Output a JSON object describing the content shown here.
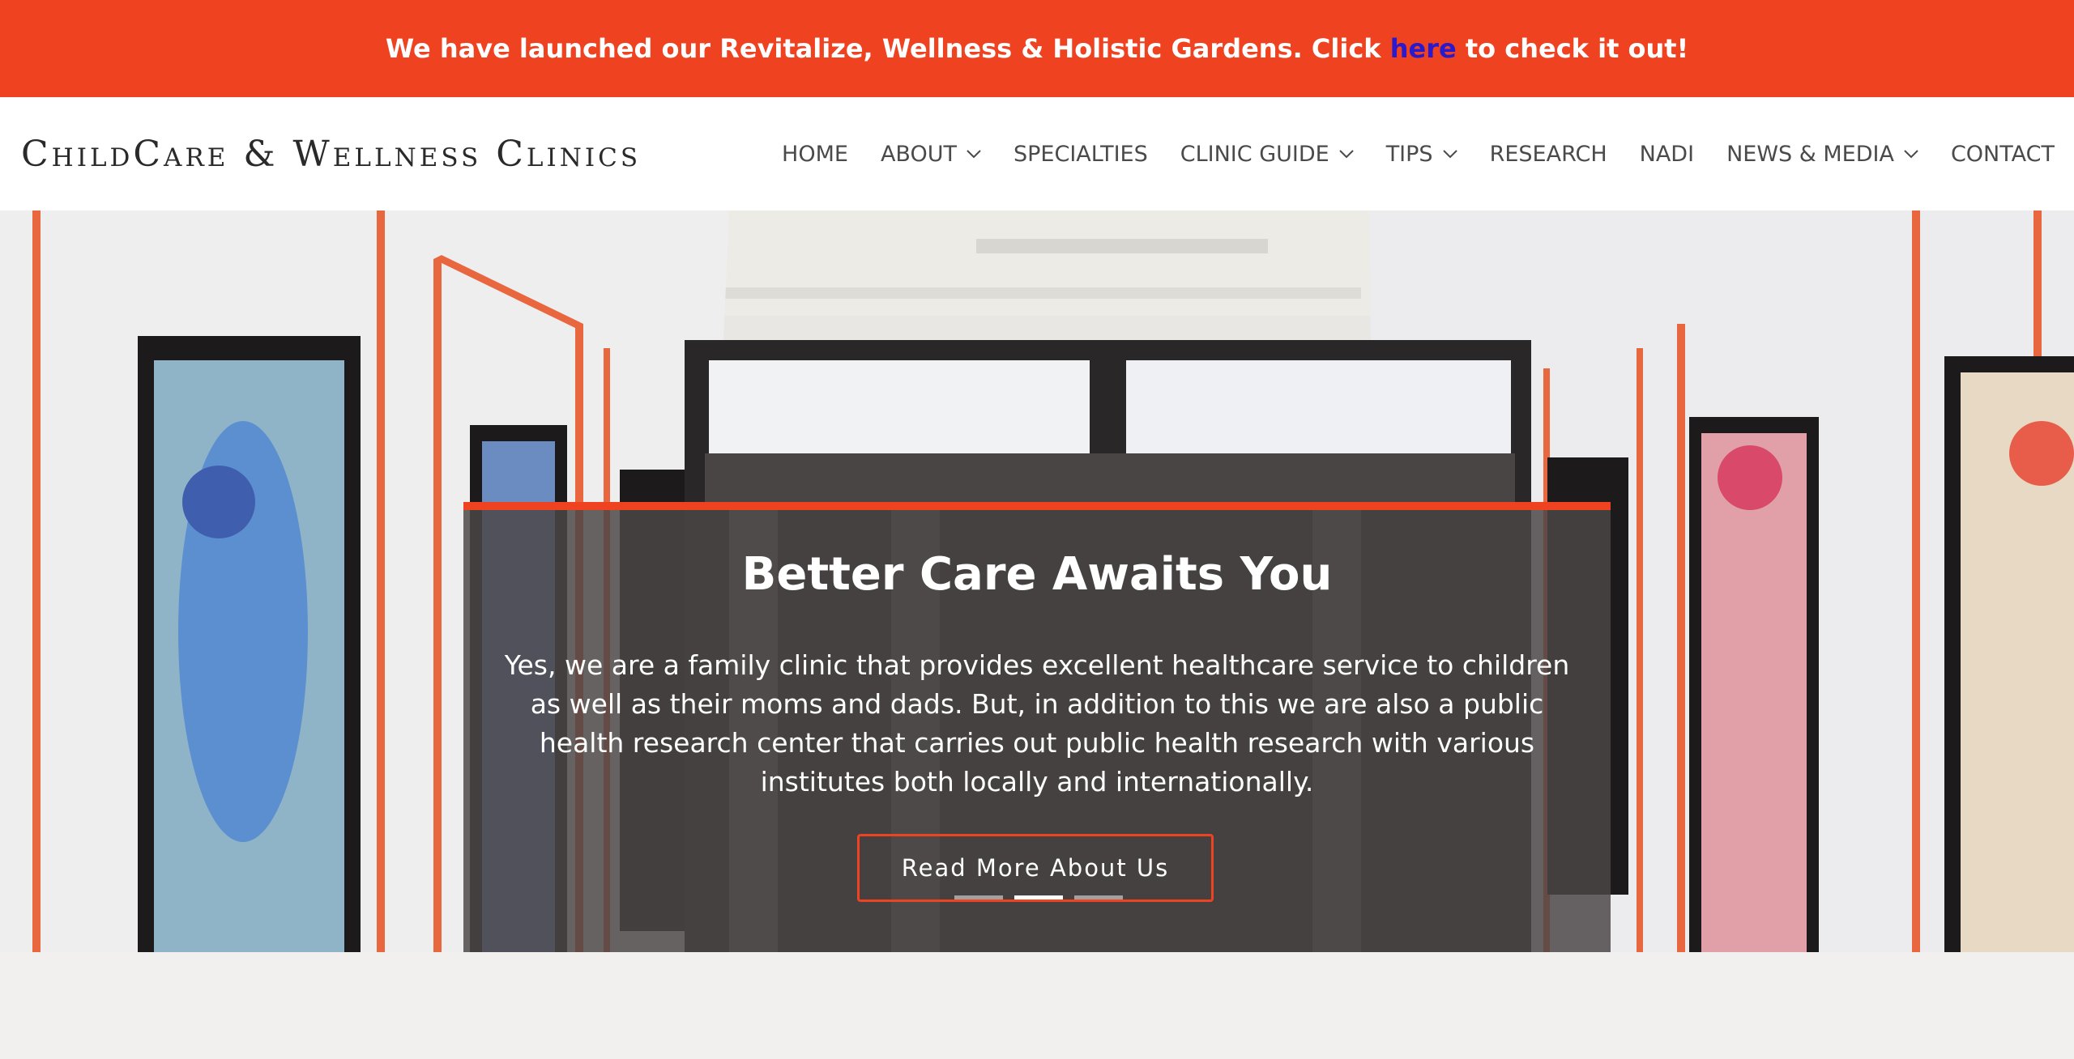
{
  "announcement": {
    "text_before": "We have launched our Revitalize, Wellness & Holistic Gardens. Click ",
    "link_text": "here",
    "text_after": " to check it out!"
  },
  "header": {
    "logo": "ChildCare & Wellness Clinics",
    "nav": [
      {
        "label": "HOME",
        "dropdown": false
      },
      {
        "label": "ABOUT",
        "dropdown": true
      },
      {
        "label": "SPECIALTIES",
        "dropdown": false
      },
      {
        "label": "CLINIC GUIDE",
        "dropdown": true
      },
      {
        "label": "TIPS",
        "dropdown": true
      },
      {
        "label": "RESEARCH",
        "dropdown": false
      },
      {
        "label": "NADI",
        "dropdown": false
      },
      {
        "label": "NEWS & MEDIA",
        "dropdown": true
      },
      {
        "label": "CONTACT",
        "dropdown": false
      }
    ]
  },
  "hero": {
    "title": "Better Care Awaits You",
    "text": "Yes, we are a family clinic that provides excellent healthcare service to children as well as their moms and dads. But, in addition to this we are also a public health research center that carries out public health research with various institutes both locally and internationally.",
    "button": "Read More About Us",
    "slides": 3,
    "active_slide": 2
  },
  "colors": {
    "accent": "#ee4220",
    "link": "#2b1acb",
    "overlay": "#4b4646"
  }
}
